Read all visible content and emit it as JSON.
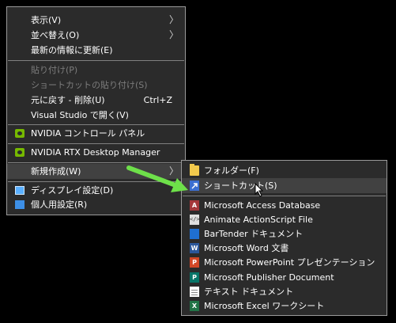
{
  "context_menu": {
    "items": [
      {
        "label": "表示(V)",
        "has_submenu": true,
        "enabled": true
      },
      {
        "label": "並べ替え(O)",
        "has_submenu": true,
        "enabled": true
      },
      {
        "label": "最新の情報に更新(E)",
        "enabled": true
      },
      {
        "label": "貼り付け(P)",
        "enabled": false
      },
      {
        "label": "ショートカットの貼り付け(S)",
        "enabled": false
      },
      {
        "label": "元に戻す - 削除(U)",
        "shortcut": "Ctrl+Z",
        "enabled": true
      },
      {
        "label": "Visual Studio で開く(V)",
        "enabled": true
      },
      {
        "label": "NVIDIA コントロール パネル",
        "icon": "nvidia-icon",
        "enabled": true
      },
      {
        "label": "NVIDIA RTX Desktop Manager",
        "icon": "nvidia-icon",
        "enabled": true
      },
      {
        "label": "新規作成(W)",
        "has_submenu": true,
        "highlighted": true,
        "enabled": true
      },
      {
        "label": "ディスプレイ設定(D)",
        "icon": "display-icon",
        "enabled": true
      },
      {
        "label": "個人用設定(R)",
        "icon": "personalize-icon",
        "enabled": true
      }
    ]
  },
  "new_submenu": {
    "items": [
      {
        "label": "フォルダー(F)",
        "icon": "folder-icon"
      },
      {
        "label": "ショートカット(S)",
        "icon": "shortcut-icon",
        "highlighted": true
      },
      {
        "label": "Microsoft Access Database",
        "icon": "access-icon",
        "icon_text": "A"
      },
      {
        "label": "Animate ActionScript File",
        "icon": "actionscript-icon",
        "icon_text": "</>"
      },
      {
        "label": "BarTender ドキュメント",
        "icon": "bartender-icon"
      },
      {
        "label": "Microsoft Word 文書",
        "icon": "word-icon",
        "icon_text": "W"
      },
      {
        "label": "Microsoft PowerPoint プレゼンテーション",
        "icon": "powerpoint-icon",
        "icon_text": "P"
      },
      {
        "label": "Microsoft Publisher Document",
        "icon": "publisher-icon",
        "icon_text": "P"
      },
      {
        "label": "テキスト ドキュメント",
        "icon": "text-document-icon"
      },
      {
        "label": "Microsoft Excel ワークシート",
        "icon": "excel-icon",
        "icon_text": "X"
      }
    ]
  },
  "submenu_arrow_glyph": "〉",
  "annotation": {
    "arrow_color": "#6ee04a"
  },
  "colors": {
    "menu_bg": "#2b2b2b",
    "highlight": "#414141",
    "disabled_text": "#7d7d7d"
  }
}
